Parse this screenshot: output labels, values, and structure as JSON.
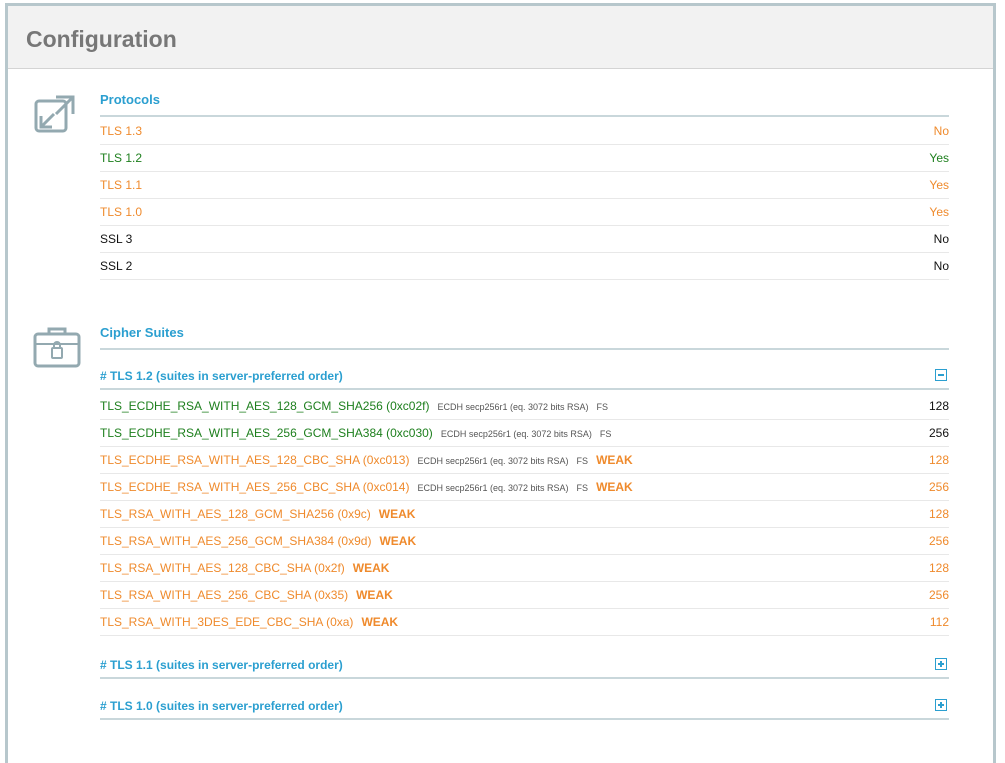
{
  "header": {
    "title": "Configuration"
  },
  "protocols": {
    "title": "Protocols",
    "items": [
      {
        "name": "TLS 1.3",
        "value": "No",
        "color": "#ef8a2c"
      },
      {
        "name": "TLS 1.2",
        "value": "Yes",
        "color": "#1d7f1d"
      },
      {
        "name": "TLS 1.1",
        "value": "Yes",
        "color": "#ef8a2c"
      },
      {
        "name": "TLS 1.0",
        "value": "Yes",
        "color": "#ef8a2c"
      },
      {
        "name": "SSL 3",
        "value": "No",
        "color": "#111111"
      },
      {
        "name": "SSL 2",
        "value": "No",
        "color": "#111111"
      }
    ]
  },
  "ciphers": {
    "title": "Cipher Suites",
    "groups": [
      {
        "label": "# TLS 1.2 (suites in server-preferred order)",
        "toggle": "minus-icon"
      },
      {
        "label": "# TLS 1.1 (suites in server-preferred order)",
        "toggle": "plus-icon"
      },
      {
        "label": "# TLS 1.0 (suites in server-preferred order)",
        "toggle": "plus-icon"
      }
    ],
    "suites": [
      {
        "name": "TLS_ECDHE_RSA_WITH_AES_128_GCM_SHA256 (0xc02f)",
        "kex": "ECDH secp256r1 (eq. 3072 bits RSA)",
        "fs": "FS",
        "weak": "",
        "bits": "128",
        "color": "#1d7f1d"
      },
      {
        "name": "TLS_ECDHE_RSA_WITH_AES_256_GCM_SHA384 (0xc030)",
        "kex": "ECDH secp256r1 (eq. 3072 bits RSA)",
        "fs": "FS",
        "weak": "",
        "bits": "256",
        "color": "#1d7f1d"
      },
      {
        "name": "TLS_ECDHE_RSA_WITH_AES_128_CBC_SHA (0xc013)",
        "kex": "ECDH secp256r1 (eq. 3072 bits RSA)",
        "fs": "FS",
        "weak": "WEAK",
        "bits": "128",
        "color": "#ef8a2c"
      },
      {
        "name": "TLS_ECDHE_RSA_WITH_AES_256_CBC_SHA (0xc014)",
        "kex": "ECDH secp256r1 (eq. 3072 bits RSA)",
        "fs": "FS",
        "weak": "WEAK",
        "bits": "256",
        "color": "#ef8a2c"
      },
      {
        "name": "TLS_RSA_WITH_AES_128_GCM_SHA256 (0x9c)",
        "kex": "",
        "fs": "",
        "weak": "WEAK",
        "bits": "128",
        "color": "#ef8a2c"
      },
      {
        "name": "TLS_RSA_WITH_AES_256_GCM_SHA384 (0x9d)",
        "kex": "",
        "fs": "",
        "weak": "WEAK",
        "bits": "256",
        "color": "#ef8a2c"
      },
      {
        "name": "TLS_RSA_WITH_AES_128_CBC_SHA (0x2f)",
        "kex": "",
        "fs": "",
        "weak": "WEAK",
        "bits": "128",
        "color": "#ef8a2c"
      },
      {
        "name": "TLS_RSA_WITH_AES_256_CBC_SHA (0x35)",
        "kex": "",
        "fs": "",
        "weak": "WEAK",
        "bits": "256",
        "color": "#ef8a2c"
      },
      {
        "name": "TLS_RSA_WITH_3DES_EDE_CBC_SHA (0xa)",
        "kex": "",
        "fs": "",
        "weak": "WEAK",
        "bits": "112",
        "color": "#ef8a2c"
      }
    ]
  }
}
